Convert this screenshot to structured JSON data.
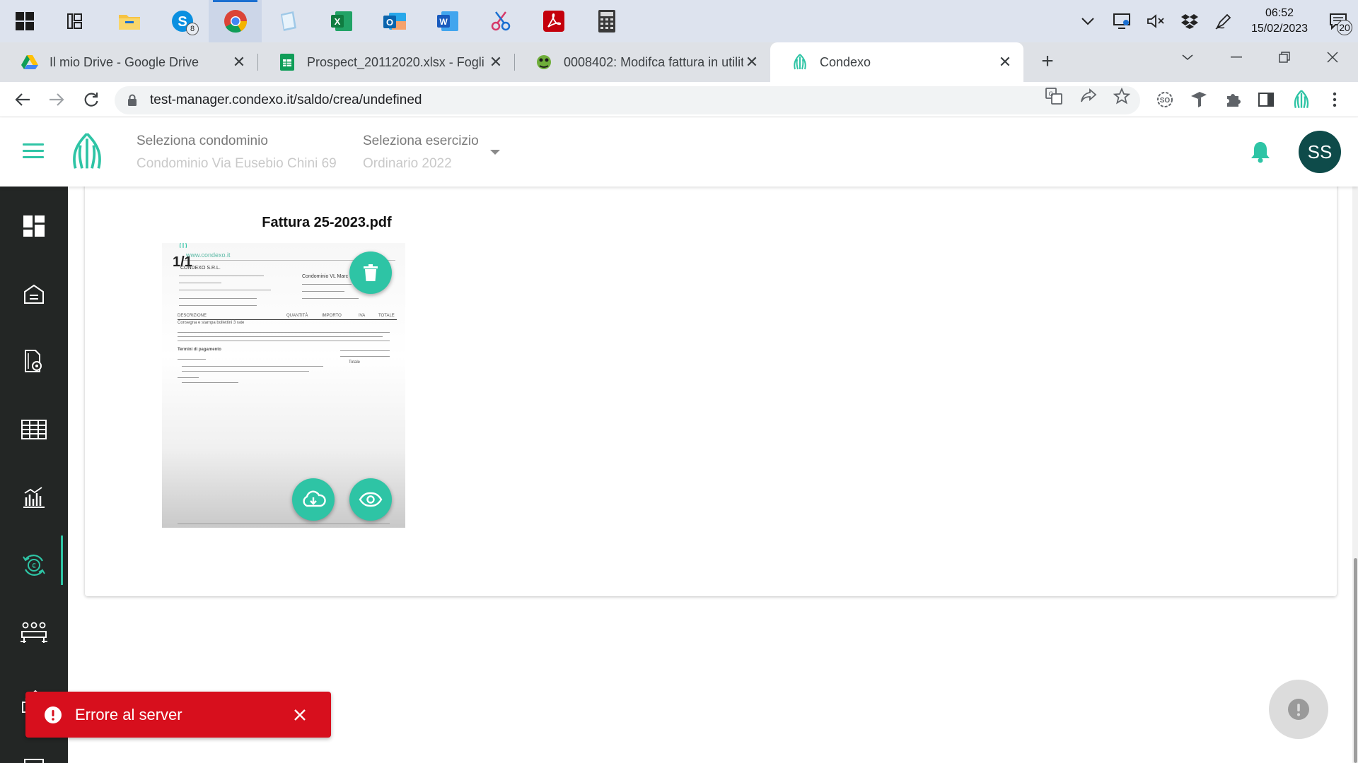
{
  "taskbar": {
    "apps": [
      {
        "name": "task-view",
        "active": false
      },
      {
        "name": "file-explorer",
        "active": false
      },
      {
        "name": "skype",
        "active": false,
        "badge": "8"
      },
      {
        "name": "chrome",
        "active": true
      },
      {
        "name": "notepad",
        "active": false
      },
      {
        "name": "excel",
        "active": false
      },
      {
        "name": "outlook",
        "active": false
      },
      {
        "name": "word",
        "active": false
      },
      {
        "name": "snipping-tool",
        "active": false
      },
      {
        "name": "acrobat",
        "active": false
      },
      {
        "name": "calculator",
        "active": false
      }
    ],
    "clock_time": "06:52",
    "clock_date": "15/02/2023",
    "notification_count": "20"
  },
  "browser": {
    "tabs": [
      {
        "title": "Il mio Drive - Google Drive",
        "active": false
      },
      {
        "title": "Prospect_20112020.xlsx - Fogli Google",
        "active": false
      },
      {
        "title": "0008402: Modifca fattura in utilità",
        "active": false
      },
      {
        "title": "Condexo",
        "active": true
      }
    ],
    "url": "test-manager.condexo.it/saldo/crea/undefined"
  },
  "header": {
    "condominio_label": "Seleziona condominio",
    "condominio_value": "Condominio Via Eusebio Chini 69",
    "esercizio_label": "Seleziona esercizio",
    "esercizio_value": "Ordinario 2022",
    "avatar_initials": "SS"
  },
  "colors": {
    "accent": "#2ec4a5",
    "sidebar_bg": "#232625",
    "avatar_bg": "#0e4b4a",
    "error": "#d70f1d"
  },
  "sidebar": {
    "items": [
      {
        "icon": "dashboard-icon"
      },
      {
        "icon": "building-icon"
      },
      {
        "icon": "document-settings-icon"
      },
      {
        "icon": "table-icon"
      },
      {
        "icon": "bank-chart-icon"
      },
      {
        "icon": "euro-cycle-icon",
        "active": true
      },
      {
        "icon": "meeting-icon"
      },
      {
        "icon": "home-tools-icon"
      },
      {
        "icon": "report-icon"
      }
    ]
  },
  "document": {
    "title": "Fattura 25-2023.pdf",
    "page_indicator": "1/1",
    "preview_text": {
      "website": "www.condexo.it",
      "company": "CONDEXO S.R.L.",
      "recipient": "Condominio VL Marc",
      "description_header": "DESCRIZIONE",
      "quantity_header": "QUANTITÀ",
      "amount_header": "IMPORTO",
      "vat_header": "IVA",
      "total_header": "TOTALE",
      "row_item": "Consegna e stampa bollettini 3 rate",
      "payment_terms": "Termini di pagamento",
      "total_label": "Totale"
    }
  },
  "toast": {
    "message": "Errore al server"
  }
}
